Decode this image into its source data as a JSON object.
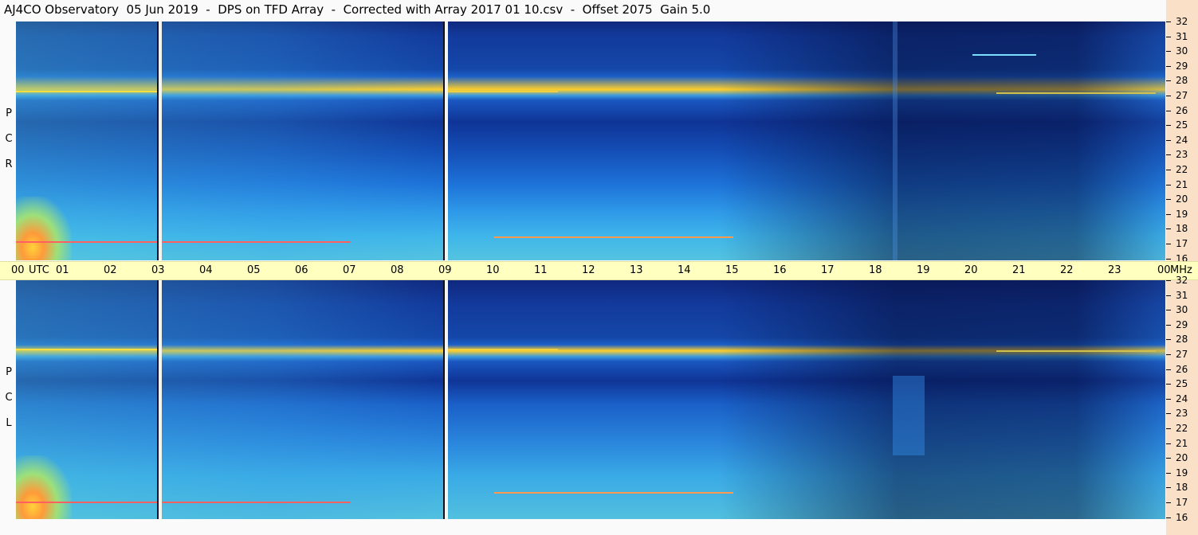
{
  "title": "AJ4CO Observatory  05 Jun 2019  -  DPS on TFD Array  -  Corrected with Array 2017 01 10.csv  -  Offset 2075  Gain 5.0",
  "panels": [
    {
      "id": "rcp",
      "side_label": [
        "P",
        "C",
        "R"
      ]
    },
    {
      "id": "lcp",
      "side_label": [
        "P",
        "C",
        "L"
      ]
    }
  ],
  "freq_ticks": [
    "32",
    "31",
    "30",
    "29",
    "28",
    "27",
    "26",
    "25",
    "24",
    "23",
    "22",
    "21",
    "20",
    "19",
    "18",
    "17",
    "16"
  ],
  "time_axis": {
    "hours": [
      "00",
      "UTC",
      "01",
      "02",
      "03",
      "04",
      "05",
      "06",
      "07",
      "08",
      "09",
      "10",
      "11",
      "12",
      "13",
      "14",
      "15",
      "16",
      "17",
      "18",
      "19",
      "20",
      "21",
      "22",
      "23",
      "00",
      "MHz"
    ]
  },
  "colors": {
    "freq_axis_bg": "#fbe0c8",
    "time_bar_bg": "#ffffc0",
    "hot": "#ffd23a",
    "dark_band": "#0a1a5c"
  }
}
